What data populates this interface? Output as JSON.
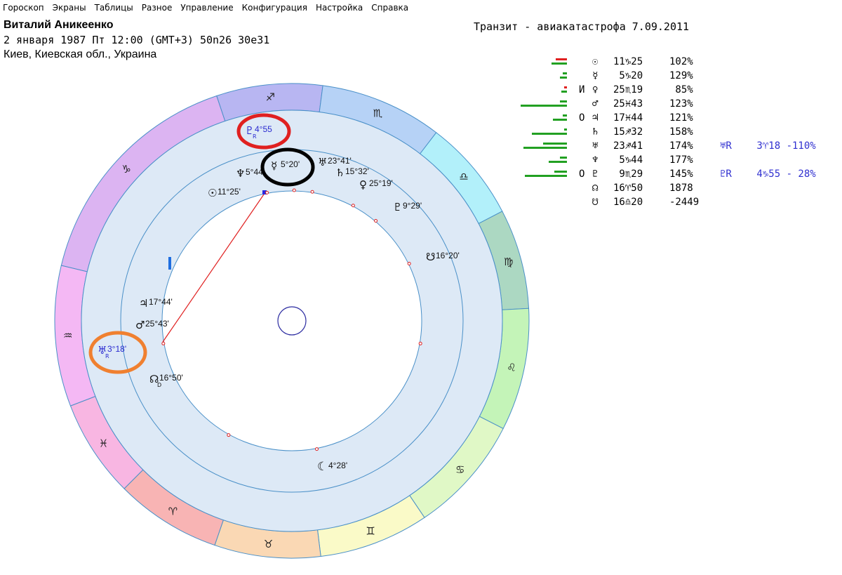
{
  "menu": [
    "Гороскоп",
    "Экраны",
    "Таблицы",
    "Разное",
    "Управление",
    "Конфигурация",
    "Настройка",
    "Справка"
  ],
  "header": {
    "name": "Виталий Аникеенко",
    "date_line": "2 января 1987  Пт  12:00 (GMT+3) 50n26  30e31",
    "place_line": "Киев, Киевская обл., Украина",
    "transit_title": "Транзит - авиакатастрофа  7.09.2011"
  },
  "zodiac_signs": [
    {
      "name": "Capricorn",
      "glyph": "♑︎",
      "color": "#dcb4f2"
    },
    {
      "name": "Sagittarius",
      "glyph": "♐︎",
      "color": "#b8b6f2"
    },
    {
      "name": "Scorpio",
      "glyph": "♏︎",
      "color": "#b6d2f6"
    },
    {
      "name": "Libra",
      "glyph": "♎︎",
      "color": "#b2f0fa"
    },
    {
      "name": "Virgo",
      "glyph": "♍︎",
      "color": "#acd8c2"
    },
    {
      "name": "Leo",
      "glyph": "♌︎",
      "color": "#c4f4b8"
    },
    {
      "name": "Cancer",
      "glyph": "♋︎",
      "color": "#e0f8c6"
    },
    {
      "name": "Gemini",
      "glyph": "♊︎",
      "color": "#fafac8"
    },
    {
      "name": "Taurus",
      "glyph": "♉︎",
      "color": "#fad8b4"
    },
    {
      "name": "Aries",
      "glyph": "♈︎",
      "color": "#f8b4b4"
    },
    {
      "name": "Pisces",
      "glyph": "♓︎",
      "color": "#f8b6e2"
    },
    {
      "name": "Aquarius",
      "glyph": "♒︎",
      "color": "#f4b8f4"
    }
  ],
  "natal_planets": [
    {
      "id": "sun",
      "glyph": "☉",
      "label": "11°25'"
    },
    {
      "id": "neptune",
      "glyph": "♆",
      "label": "5°44'"
    },
    {
      "id": "mercury",
      "glyph": "☿",
      "label": "5°20'"
    },
    {
      "id": "uranus",
      "glyph": "♅",
      "label": "23°41'"
    },
    {
      "id": "saturn",
      "glyph": "♄",
      "label": "15°32'"
    },
    {
      "id": "venus",
      "glyph": "♀",
      "label": "25°19'"
    },
    {
      "id": "pluto",
      "glyph": "♇",
      "label": "9°29'"
    },
    {
      "id": "south-node",
      "glyph": "☋",
      "label": "16°20'"
    },
    {
      "id": "jupiter",
      "glyph": "♃",
      "label": "17°44'"
    },
    {
      "id": "mars",
      "glyph": "♂",
      "label": "25°43'"
    },
    {
      "id": "north-node",
      "glyph": "☊",
      "sub": "D",
      "label": "16°50'"
    },
    {
      "id": "moon",
      "glyph": "☾",
      "label": "4°28'"
    }
  ],
  "transit_planets": [
    {
      "id": "transit-pluto",
      "glyph": "♇",
      "sub": "R",
      "label": "4°55"
    },
    {
      "id": "transit-uranus",
      "glyph": "♅",
      "sub": "R",
      "label": "3°18'"
    }
  ],
  "table": [
    {
      "glyph": "☉",
      "mark": "",
      "deg": "11♑25",
      "pct": "102%",
      "bars": [
        [
          16,
          "#e02020"
        ],
        [
          22,
          "#22a022"
        ]
      ]
    },
    {
      "glyph": "☿",
      "mark": "",
      "deg": " 5♑20",
      "pct": "129%",
      "bars": [
        [
          6,
          "#22a022"
        ],
        [
          10,
          "#22a022"
        ]
      ]
    },
    {
      "glyph": "♀",
      "mark": "И",
      "deg": "25♏19",
      "pct": " 85%",
      "bars": [
        [
          4,
          "#e02020"
        ],
        [
          8,
          "#22a022"
        ]
      ]
    },
    {
      "glyph": "♂",
      "mark": "",
      "deg": "25♓43",
      "pct": "123%",
      "bars": [
        [
          10,
          "#22a022"
        ],
        [
          66,
          "#22a022"
        ]
      ]
    },
    {
      "glyph": "♃",
      "mark": "О",
      "deg": "17♓44",
      "pct": "121%",
      "bars": [
        [
          6,
          "#22a022"
        ],
        [
          20,
          "#22a022"
        ]
      ]
    },
    {
      "glyph": "♄",
      "mark": "",
      "deg": "15♐32",
      "pct": "158%",
      "bars": [
        [
          4,
          "#22a022"
        ],
        [
          50,
          "#22a022"
        ]
      ]
    },
    {
      "glyph": "♅",
      "mark": "",
      "deg": "23♐41",
      "pct": "174%",
      "bars": [
        [
          34,
          "#22a022"
        ],
        [
          62,
          "#22a022"
        ]
      ],
      "transit": "♅R",
      "tdeg": " 3♈18 -110%"
    },
    {
      "glyph": "♆",
      "mark": "",
      "deg": " 5♑44",
      "pct": "177%",
      "bars": [
        [
          10,
          "#22a022"
        ],
        [
          26,
          "#22a022"
        ]
      ]
    },
    {
      "glyph": "♇",
      "mark": "О",
      "deg": " 9♏29",
      "pct": "145%",
      "bars": [
        [
          18,
          "#22a022"
        ],
        [
          60,
          "#22a022"
        ]
      ],
      "transit": "♇R",
      "tdeg": " 4♑55 - 28%"
    },
    {
      "glyph": "☊",
      "mark": "",
      "deg": "16♈50",
      "pct": "1878",
      "bars": []
    },
    {
      "glyph": "☋",
      "mark": "",
      "deg": "16♎20",
      "pct": "-2449",
      "bars": []
    }
  ],
  "highlights": [
    {
      "name": "red-highlight-circle",
      "color": "#e02020"
    },
    {
      "name": "black-highlight-circle",
      "color": "#000000"
    },
    {
      "name": "orange-highlight-circle",
      "color": "#f08030"
    }
  ]
}
